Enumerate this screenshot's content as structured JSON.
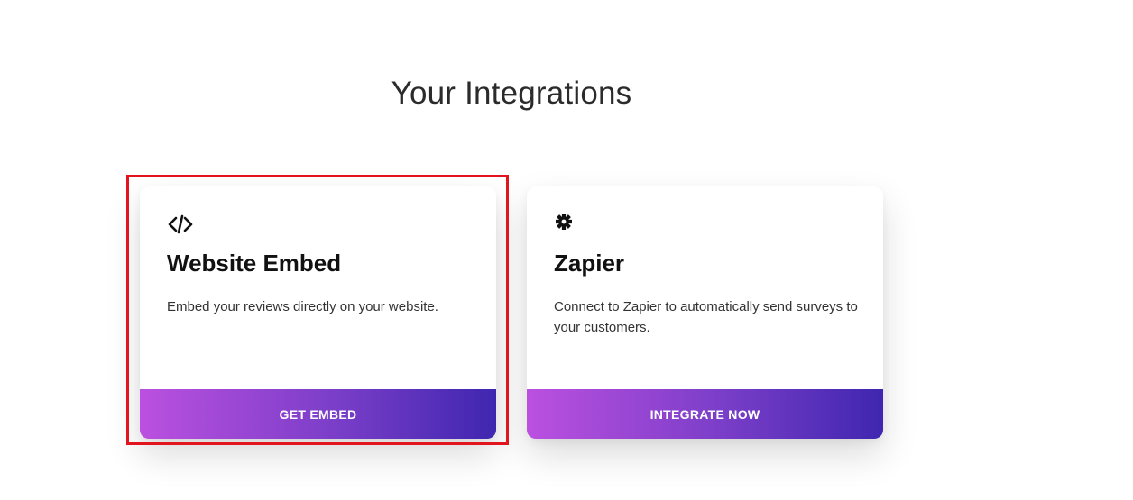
{
  "page": {
    "title": "Your Integrations"
  },
  "integrations": [
    {
      "icon": "code-icon",
      "title": "Website Embed",
      "description": "Embed your reviews directly on your website.",
      "button_label": "GET EMBED"
    },
    {
      "icon": "zapier-asterisk-icon",
      "title": "Zapier",
      "description": "Connect to Zapier to automatically send surveys to your customers.",
      "button_label": "INTEGRATE NOW"
    }
  ],
  "colors": {
    "button_gradient_start": "#bb50e0",
    "button_gradient_end": "#3f26b0",
    "highlight_border": "#e2141e",
    "title_text": "#2b2b2b"
  }
}
